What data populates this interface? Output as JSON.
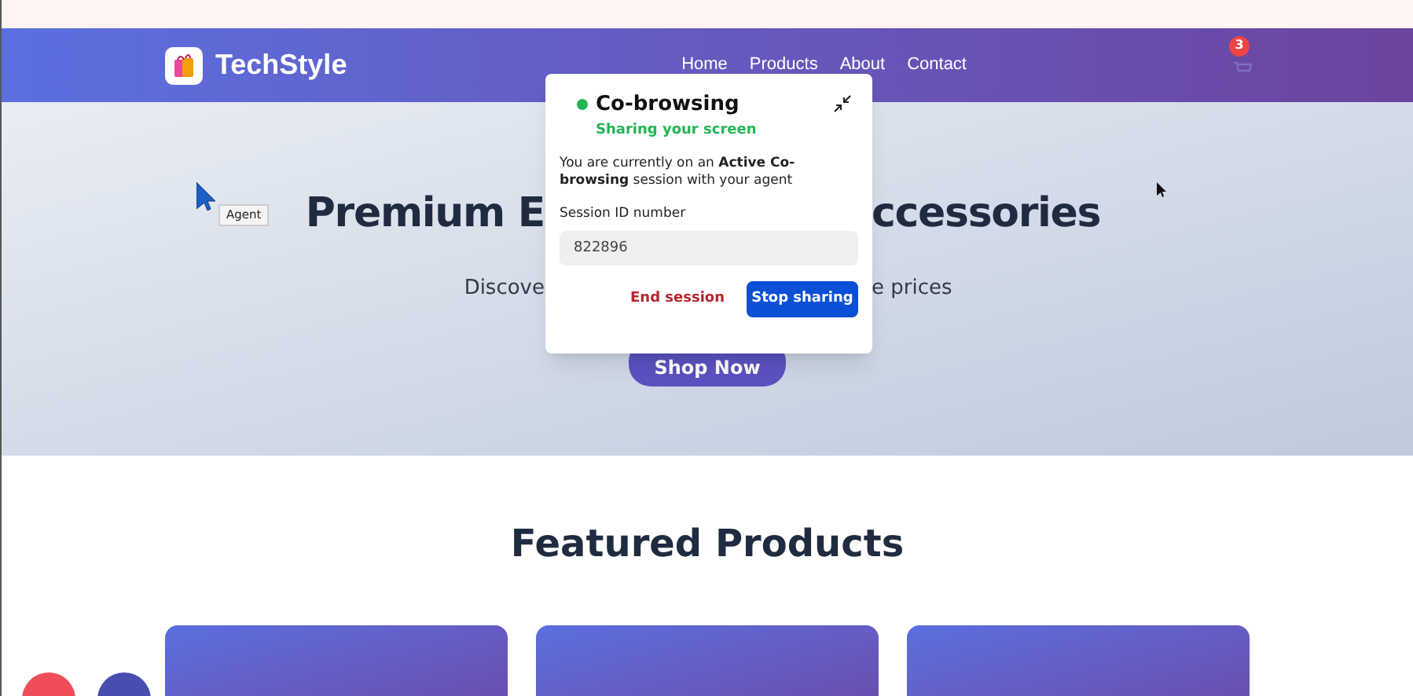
{
  "header": {
    "brand": "TechStyle",
    "nav": [
      {
        "label": "Home"
      },
      {
        "label": "Products"
      },
      {
        "label": "About"
      },
      {
        "label": "Contact"
      }
    ],
    "cart_count": "3"
  },
  "hero": {
    "title_left": "Premium E",
    "title_right": "ccessories",
    "subtitle_left": "Discove",
    "subtitle_right": "e prices",
    "button": "Shop Now"
  },
  "agent_cursor": {
    "label": "Agent"
  },
  "cobrowse": {
    "title": "Co-browsing",
    "status": "Sharing your screen",
    "active": true,
    "message": "You are currently on an **Active Co-browsing** session with your agent",
    "session_label": "Session ID number",
    "session_id": "822896",
    "end_button": "End session",
    "stop_button": "Stop sharing"
  },
  "featured": {
    "title": "Featured Products",
    "cards": [
      {
        "kind": "card"
      },
      {
        "kind": "card"
      },
      {
        "kind": "card"
      }
    ]
  }
}
